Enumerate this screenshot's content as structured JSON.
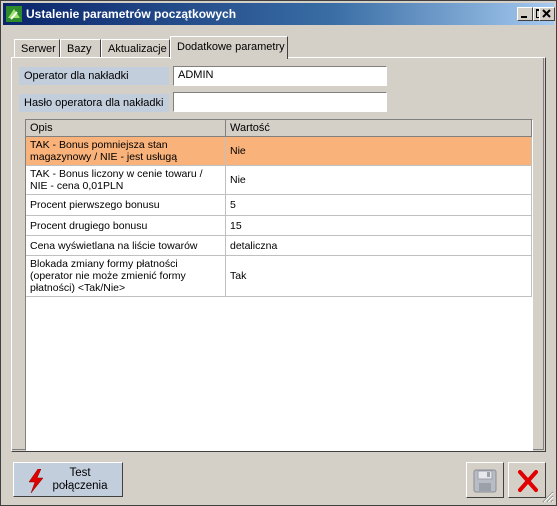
{
  "window": {
    "title": "Ustalenie parametrów początkowych"
  },
  "tabs": [
    {
      "label": "Serwer"
    },
    {
      "label": "Bazy"
    },
    {
      "label": "Aktualizacje"
    },
    {
      "label": "Dodatkowe parametry",
      "active": true
    }
  ],
  "form": {
    "operator_label": "Operator dla nakładki",
    "operator_value": "ADMIN",
    "password_label": "Hasło operatora dla nakładki",
    "password_value": ""
  },
  "grid": {
    "headers": {
      "opis": "Opis",
      "wartosc": "Wartość"
    },
    "rows": [
      {
        "opis": "TAK - Bonus pomniejsza stan magazynowy / NIE - jest usługą",
        "wartosc": "Nie",
        "selected": true
      },
      {
        "opis": "TAK - Bonus liczony w cenie towaru / NIE - cena 0,01PLN",
        "wartosc": "Nie"
      },
      {
        "opis": "Procent pierwszego bonusu",
        "wartosc": "5"
      },
      {
        "opis": "Procent drugiego bonusu",
        "wartosc": "15"
      },
      {
        "opis": "Cena wyświetlana na liście towarów",
        "wartosc": "detaliczna"
      },
      {
        "opis": "Blokada zmiany formy płatności (operator nie może zmienić formy płatności) <Tak/Nie>",
        "wartosc": "Tak"
      }
    ]
  },
  "buttons": {
    "test_line1": "Test",
    "test_line2": "połączenia"
  },
  "icons": {
    "app": "app-logo-icon",
    "test": "lightning-icon",
    "save": "floppy-disk-icon",
    "cancel": "red-x-icon"
  },
  "colors": {
    "selected_row": "#f8b27a",
    "label_bg": "#c3cedd",
    "titlebar": "#0a246a"
  }
}
